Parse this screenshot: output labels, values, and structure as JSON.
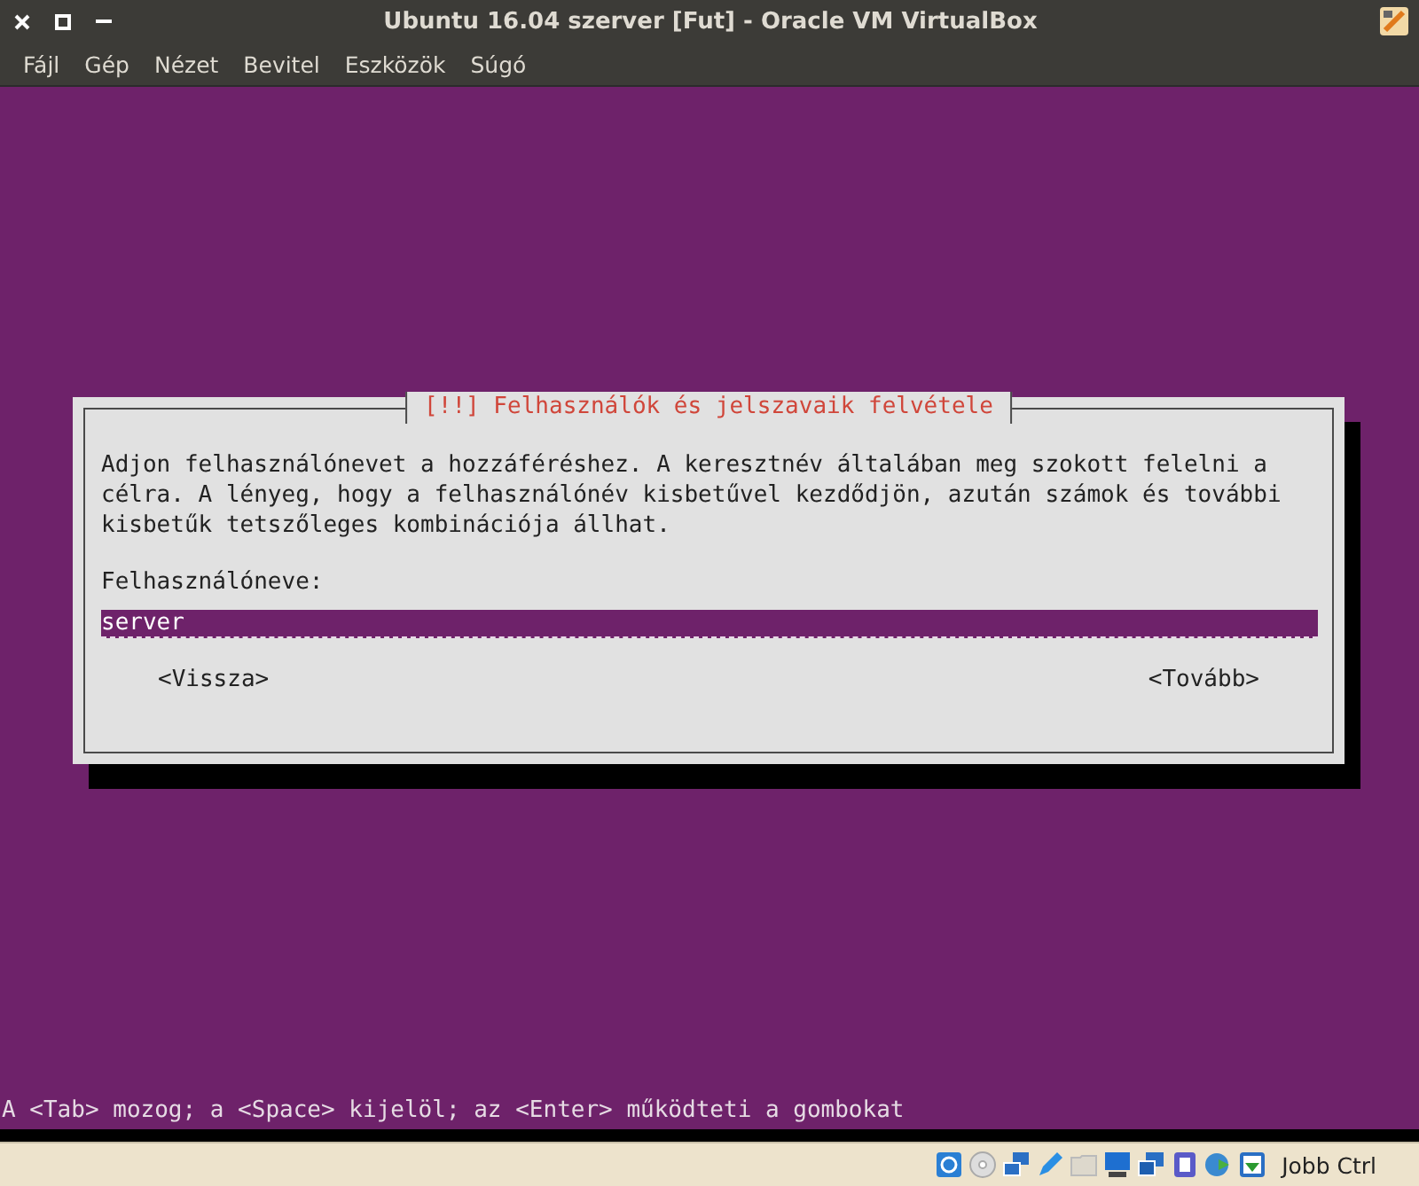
{
  "window": {
    "title": "Ubuntu 16.04 szerver [Fut] - Oracle VM VirtualBox"
  },
  "menu": [
    "Fájl",
    "Gép",
    "Nézet",
    "Bevitel",
    "Eszközök",
    "Súgó"
  ],
  "dialog": {
    "title": "[!!] Felhasználók és jelszavaik felvétele",
    "paragraph": [
      "Adjon felhasználónevet a hozzáféréshez. A keresztnév általában meg szokott felelni a",
      "célra. A lényeg, hogy a felhasználónév kisbetűvel kezdődjön, azután számok és további",
      "kisbetűk tetszőleges kombinációja állhat."
    ],
    "field_label": "Felhasználóneve:",
    "field_value": "server",
    "buttons": [
      "<Vissza>",
      "<Tovább>"
    ]
  },
  "console_hint": "A <Tab> mozog; a <Space> kijelöl; az <Enter> működteti a gombokat",
  "status_bar": {
    "host_key": "Jobb Ctrl"
  }
}
